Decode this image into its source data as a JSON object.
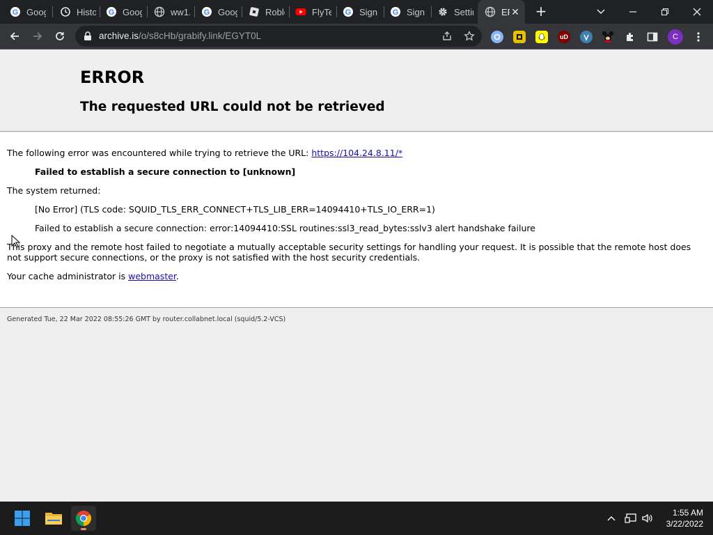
{
  "browser": {
    "tabs": [
      {
        "title": "Google",
        "icon": "google-icon"
      },
      {
        "title": "History",
        "icon": "history-icon"
      },
      {
        "title": "Google",
        "icon": "google-icon"
      },
      {
        "title": "ww1.",
        "icon": "globe-icon"
      },
      {
        "title": "Google",
        "icon": "google-icon"
      },
      {
        "title": "Roblox",
        "icon": "roblox-icon"
      },
      {
        "title": "FlyTe",
        "icon": "youtube-icon"
      },
      {
        "title": "Sign",
        "icon": "google-icon"
      },
      {
        "title": "Sign",
        "icon": "google-icon"
      },
      {
        "title": "Settir",
        "icon": "gear-icon"
      },
      {
        "title": "ERROR",
        "icon": "globe-icon",
        "active": true
      }
    ],
    "url_host": "archive.is",
    "url_path": "/o/s8cHb/grabify.link/EGYT0L",
    "profile_initial": "C"
  },
  "page": {
    "title": "ERROR",
    "subtitle": "The requested URL could not be retrieved",
    "encountered_prefix": "The following error was encountered while trying to retrieve the URL: ",
    "encountered_url": "https://104.24.8.11/*",
    "failed_line": "Failed to establish a secure connection to [unknown]",
    "system_returned": "The system returned:",
    "no_error_line": "[No Error] (TLS code: SQUID_TLS_ERR_CONNECT+TLS_LIB_ERR=14094410+TLS_IO_ERR=1)",
    "ssl_line": "Failed to establish a secure connection: error:14094410:SSL routines:ssl3_read_bytes:sslv3 alert handshake failure",
    "explanation": "This proxy and the remote host failed to negotiate a mutually acceptable security settings for handling your request. It is possible that the remote host does not support secure connections, or the proxy is not satisfied with the host security credentials.",
    "admin_prefix": "Your cache administrator is ",
    "admin_link": "webmaster",
    "admin_suffix": ".",
    "footer": "Generated Tue, 22 Mar 2022 08:55:26 GMT by router.collabnet.local (squid/5.2-VCS)"
  },
  "taskbar": {
    "time": "1:55 AM",
    "date": "3/22/2022"
  },
  "colors": {
    "tabstrip": "#202124",
    "toolbar": "#35363a",
    "link": "#1a0dab"
  }
}
